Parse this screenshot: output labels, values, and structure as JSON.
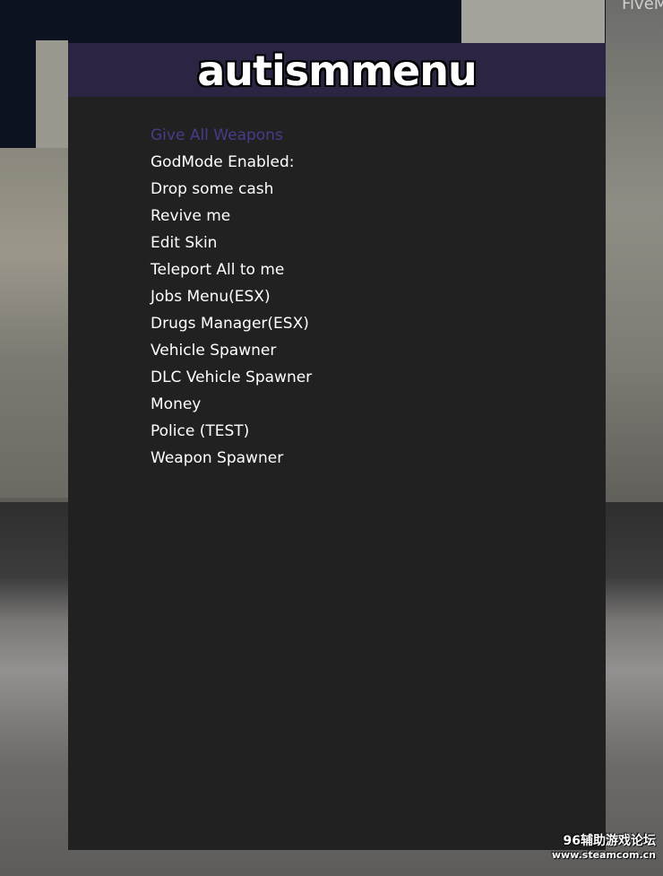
{
  "background": {
    "corner_text": "FiveM"
  },
  "menu": {
    "title": "autismmenu",
    "header_color": "#2c2443",
    "panel_color": "#212121",
    "selected_color": "#4b3a8a",
    "selected_index": 0,
    "items": [
      {
        "label": "Give All Weapons"
      },
      {
        "label": "GodMode Enabled:"
      },
      {
        "label": "Drop some cash"
      },
      {
        "label": "Revive me"
      },
      {
        "label": "Edit Skin"
      },
      {
        "label": "Teleport All to me"
      },
      {
        "label": "Jobs Menu(ESX)"
      },
      {
        "label": "Drugs Manager(ESX)"
      },
      {
        "label": "Vehicle Spawner"
      },
      {
        "label": "DLC Vehicle Spawner"
      },
      {
        "label": "Money"
      },
      {
        "label": "Police (TEST)"
      },
      {
        "label": "Weapon Spawner"
      }
    ]
  },
  "watermark": {
    "line1": "96辅助游戏论坛",
    "line2": "www.steamcom.cn"
  }
}
